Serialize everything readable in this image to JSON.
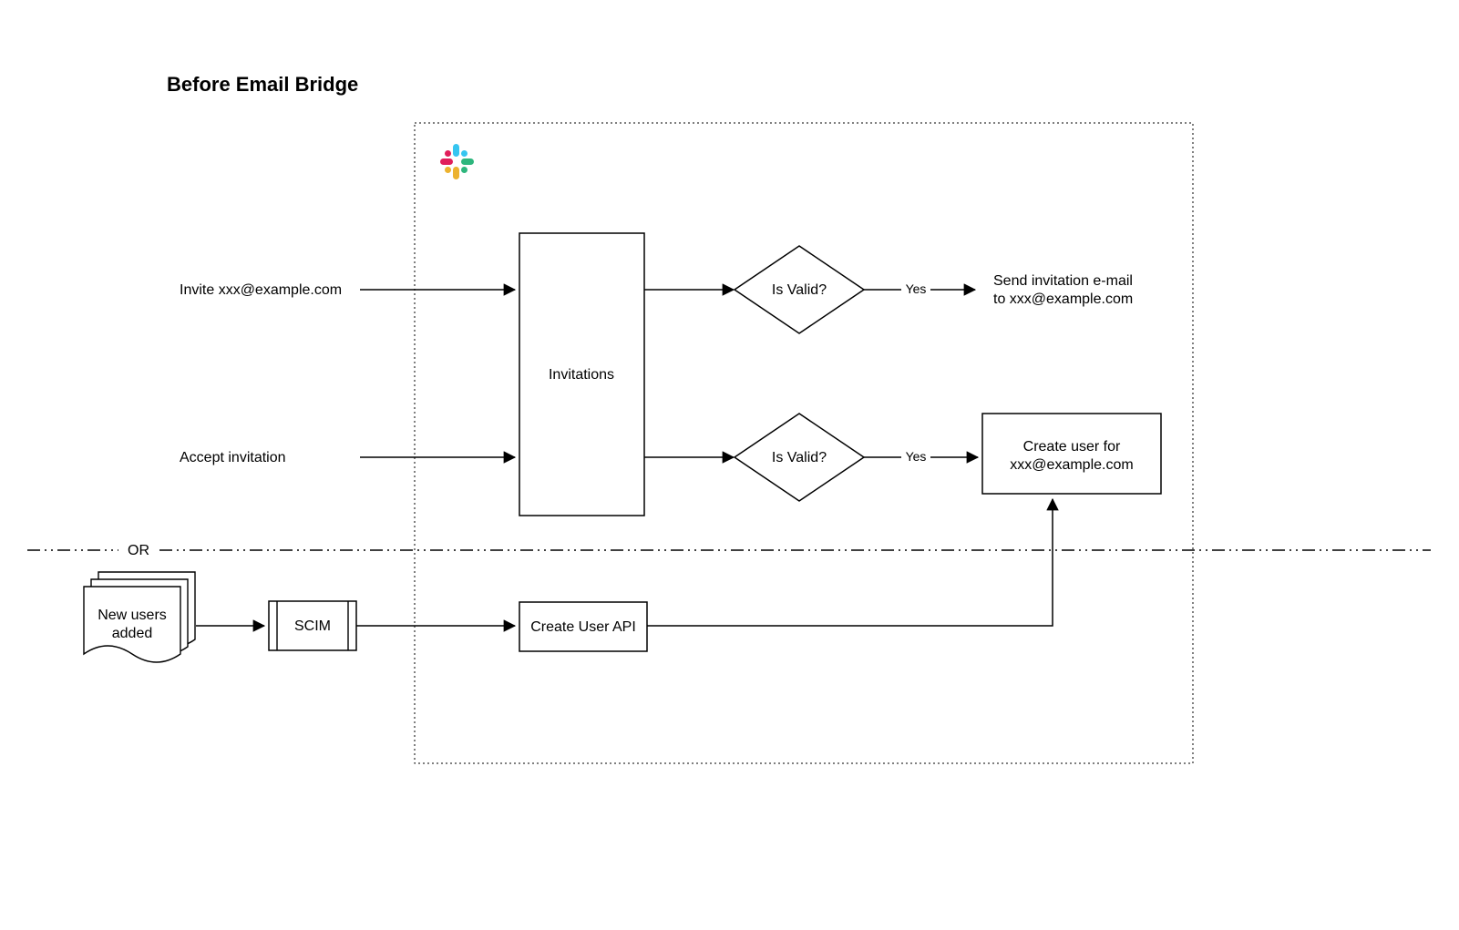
{
  "title": "Before Email Bridge",
  "inputs": {
    "invite": "Invite xxx@example.com",
    "accept": "Accept invitation"
  },
  "nodes": {
    "invitations": "Invitations",
    "valid1": "Is Valid?",
    "valid2": "Is Valid?",
    "sendEmail1": "Send invitation e-mail",
    "sendEmail2": "to xxx@example.com",
    "createUser1": "Create user for",
    "createUser2": "xxx@example.com",
    "newUsers1": "New users",
    "newUsers2": "added",
    "scim": "SCIM",
    "createUserApi": "Create User API"
  },
  "edges": {
    "yes1": "Yes",
    "yes2": "Yes"
  },
  "divider": "OR"
}
